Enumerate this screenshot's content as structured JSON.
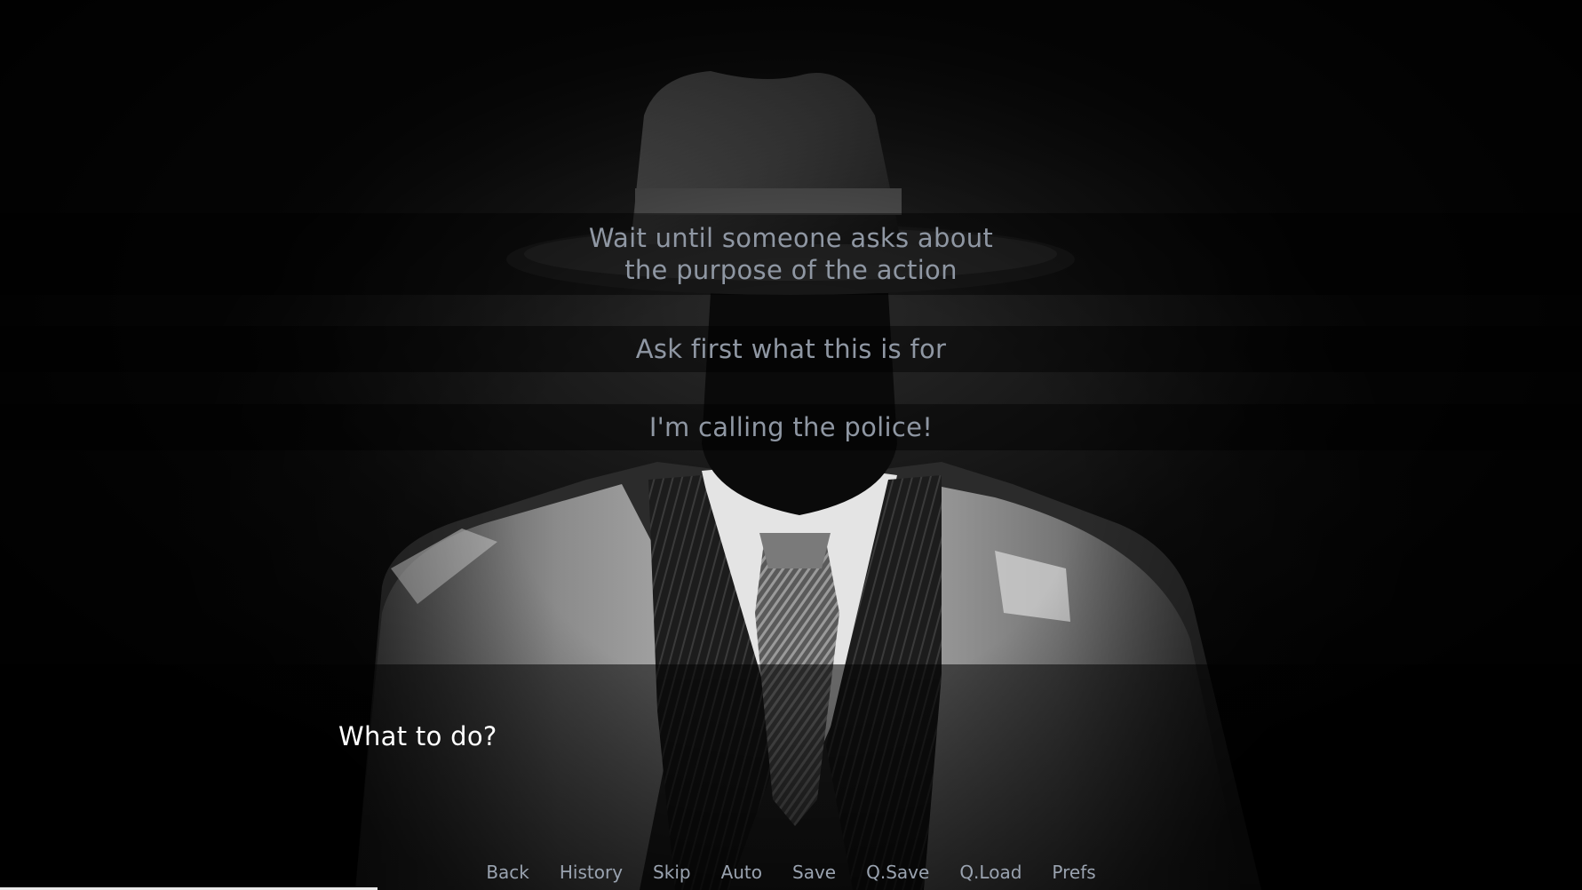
{
  "choices": [
    {
      "label": "Wait until someone asks about\nthe purpose of the action"
    },
    {
      "label": "Ask first what this is for"
    },
    {
      "label": "I'm calling the police!"
    }
  ],
  "dialogue": {
    "text": "What to do?"
  },
  "quick_menu": {
    "back": "Back",
    "history": "History",
    "skip": "Skip",
    "auto": "Auto",
    "save": "Save",
    "q_save": "Q.Save",
    "q_load": "Q.Load",
    "prefs": "Prefs"
  },
  "background": {
    "subject": "faceless man in fedora and trench coat",
    "tone": "black-and-white noir"
  },
  "colors": {
    "choice_text": "#8f97a3",
    "dialogue_text": "#ffffff",
    "menu_text": "#9aa3b0"
  }
}
